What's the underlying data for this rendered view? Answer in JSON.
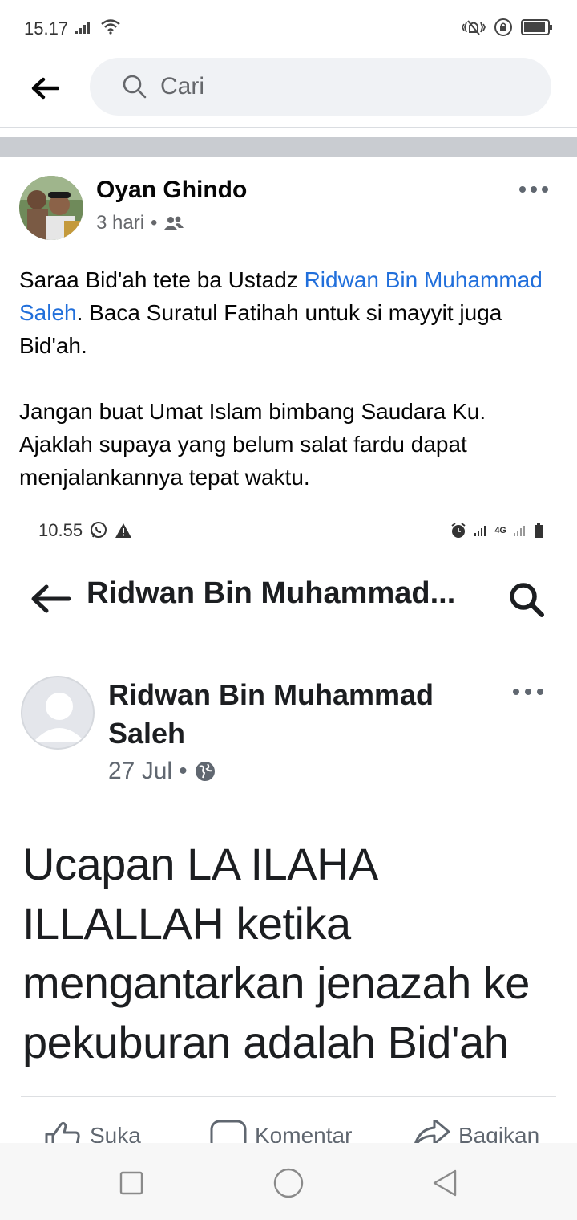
{
  "status_bar": {
    "time": "15.17"
  },
  "search": {
    "placeholder": "Cari"
  },
  "post": {
    "author": "Oyan Ghindo",
    "time": "3 hari",
    "separator": "•",
    "audience_icon": "friends-icon",
    "paragraph1_before": "Saraa Bid'ah tete ba Ustadz ",
    "paragraph1_link": "Ridwan Bin Muhammad Saleh",
    "paragraph1_after": ". Baca Suratul Fatihah untuk si mayyit juga Bid'ah.",
    "paragraph2": "Jangan buat Umat Islam bimbang Saudara Ku. Ajaklah supaya yang belum salat fardu dapat menjalankannya tepat waktu.",
    "link_color": "#216fdb"
  },
  "embedded": {
    "status_time": "10.55",
    "network_label": "4G",
    "page_title": "Ridwan Bin Muhammad...",
    "author": "Ridwan Bin Muhammad Saleh",
    "date": "27 Jul",
    "separator": "•",
    "audience_icon": "globe-icon",
    "body": "Ucapan LA ILAHA ILLALLAH ketika mengantarkan jenazah ke pekuburan adalah Bid'ah"
  },
  "actions": {
    "like": "Suka",
    "comment": "Komentar",
    "share": "Bagikan"
  },
  "navbar": {
    "icons": [
      "recents-square-icon",
      "home-circle-icon",
      "back-triangle-icon"
    ]
  }
}
